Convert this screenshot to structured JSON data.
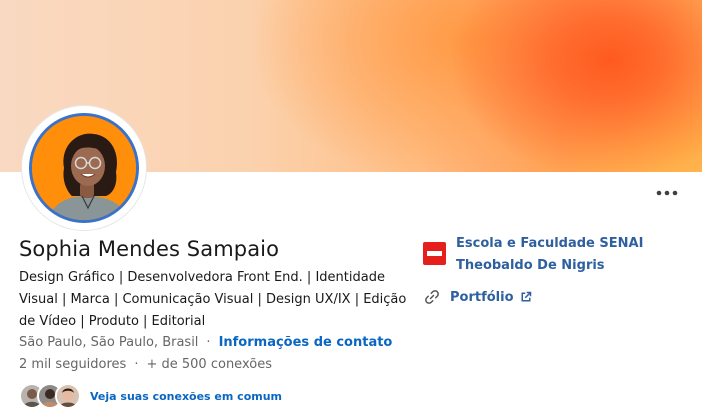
{
  "profile": {
    "name": "Sophia Mendes Sampaio",
    "headline": "Design Gráfico | Desenvolvedora Front End. | Identidade Visual | Marca | Comunicação Visual | Design UX/IX | Edição de Vídeo | Produto | Editorial",
    "location": "São Paulo, São Paulo, Brasil",
    "separator": "·",
    "contact_info_label": "Informações de contato",
    "followers": "2 mil seguidores",
    "connections": "+ de 500 conexões",
    "mutual_connections_label": "Veja suas conexões em comum"
  },
  "education": {
    "school_line1": "Escola e Faculdade SENAI",
    "school_line2": "Theobaldo De Nigris",
    "logo_color": "#e5201c"
  },
  "links": {
    "portfolio_label": "Portfólio"
  },
  "icons": {
    "more": "more-horizontal-icon",
    "link": "link-icon",
    "external": "external-link-icon"
  },
  "colors": {
    "accent_link": "#0a66c2",
    "side_link": "#2e5f9f",
    "avatar_bg": "#ff8f0a",
    "avatar_ring": "#3a72c9"
  }
}
